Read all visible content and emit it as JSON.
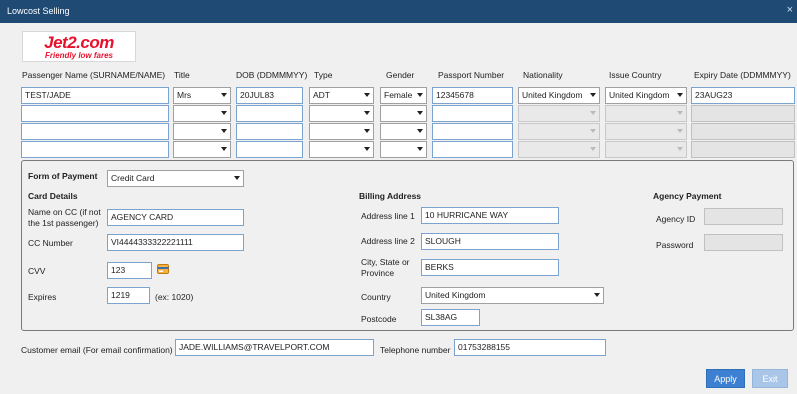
{
  "window": {
    "title": "Lowcost Selling",
    "close_glyph": "×"
  },
  "logo": {
    "brand": "Jet2.com",
    "tagline": "Friendly low fares"
  },
  "passenger_grid": {
    "headers": {
      "name": "Passenger Name (SURNAME/NAME)",
      "title": "Title",
      "dob": "DOB (DDMMMYY)",
      "type": "Type",
      "gender": "Gender",
      "passport": "Passport Number",
      "nationality": "Nationality",
      "issue_country": "Issue Country",
      "expiry": "Expiry Date (DDMMMYY)"
    },
    "rows": [
      {
        "name": "TEST/JADE",
        "title": "Mrs",
        "dob": "20JUL83",
        "type": "ADT",
        "gender": "Female",
        "passport": "12345678",
        "nationality": "United Kingdom",
        "issue_country": "United Kingdom",
        "expiry": "23AUG23"
      },
      {
        "name": "",
        "title": "",
        "dob": "",
        "type": "",
        "gender": "",
        "passport": "",
        "nationality": "",
        "issue_country": "",
        "expiry": ""
      },
      {
        "name": "",
        "title": "",
        "dob": "",
        "type": "",
        "gender": "",
        "passport": "",
        "nationality": "",
        "issue_country": "",
        "expiry": ""
      },
      {
        "name": "",
        "title": "",
        "dob": "",
        "type": "",
        "gender": "",
        "passport": "",
        "nationality": "",
        "issue_country": "",
        "expiry": ""
      }
    ]
  },
  "payment": {
    "form_label": "Form of Payment",
    "form_value": "Credit Card",
    "card": {
      "heading": "Card Details",
      "name_label": "Name on CC (if not the 1st passenger)",
      "name_value": "AGENCY CARD",
      "number_label": "CC Number",
      "number_value": "VI4444333322221111",
      "cvv_label": "CVV",
      "cvv_value": "123",
      "card_icon": "credit-card-icon",
      "expires_label": "Expires",
      "expires_value": "1219",
      "expires_hint": "(ex: 1020)"
    },
    "billing": {
      "heading": "Billing Address",
      "line1_label": "Address line 1",
      "line1_value": "10 HURRICANE WAY",
      "line2_label": "Address line 2",
      "line2_value": "SLOUGH",
      "city_label": "City, State or Province",
      "city_value": "BERKS",
      "country_label": "Country",
      "country_value": "United Kingdom",
      "postcode_label": "Postcode",
      "postcode_value": "SL38AG"
    },
    "agency": {
      "heading": "Agency Payment",
      "id_label": "Agency ID",
      "id_value": "",
      "password_label": "Password",
      "password_value": ""
    }
  },
  "contact": {
    "email_label": "Customer email (For email confirmation)",
    "email_value": "JADE.WILLIAMS@TRAVELPORT.COM",
    "phone_label": "Telephone number",
    "phone_value": "01753288155"
  },
  "buttons": {
    "apply": "Apply",
    "exit": "Exit"
  },
  "colors": {
    "titlebar": "#1e4a73",
    "brand_red": "#e8112d",
    "apply": "#3d7fd0",
    "exit": "#a9c6e8"
  }
}
